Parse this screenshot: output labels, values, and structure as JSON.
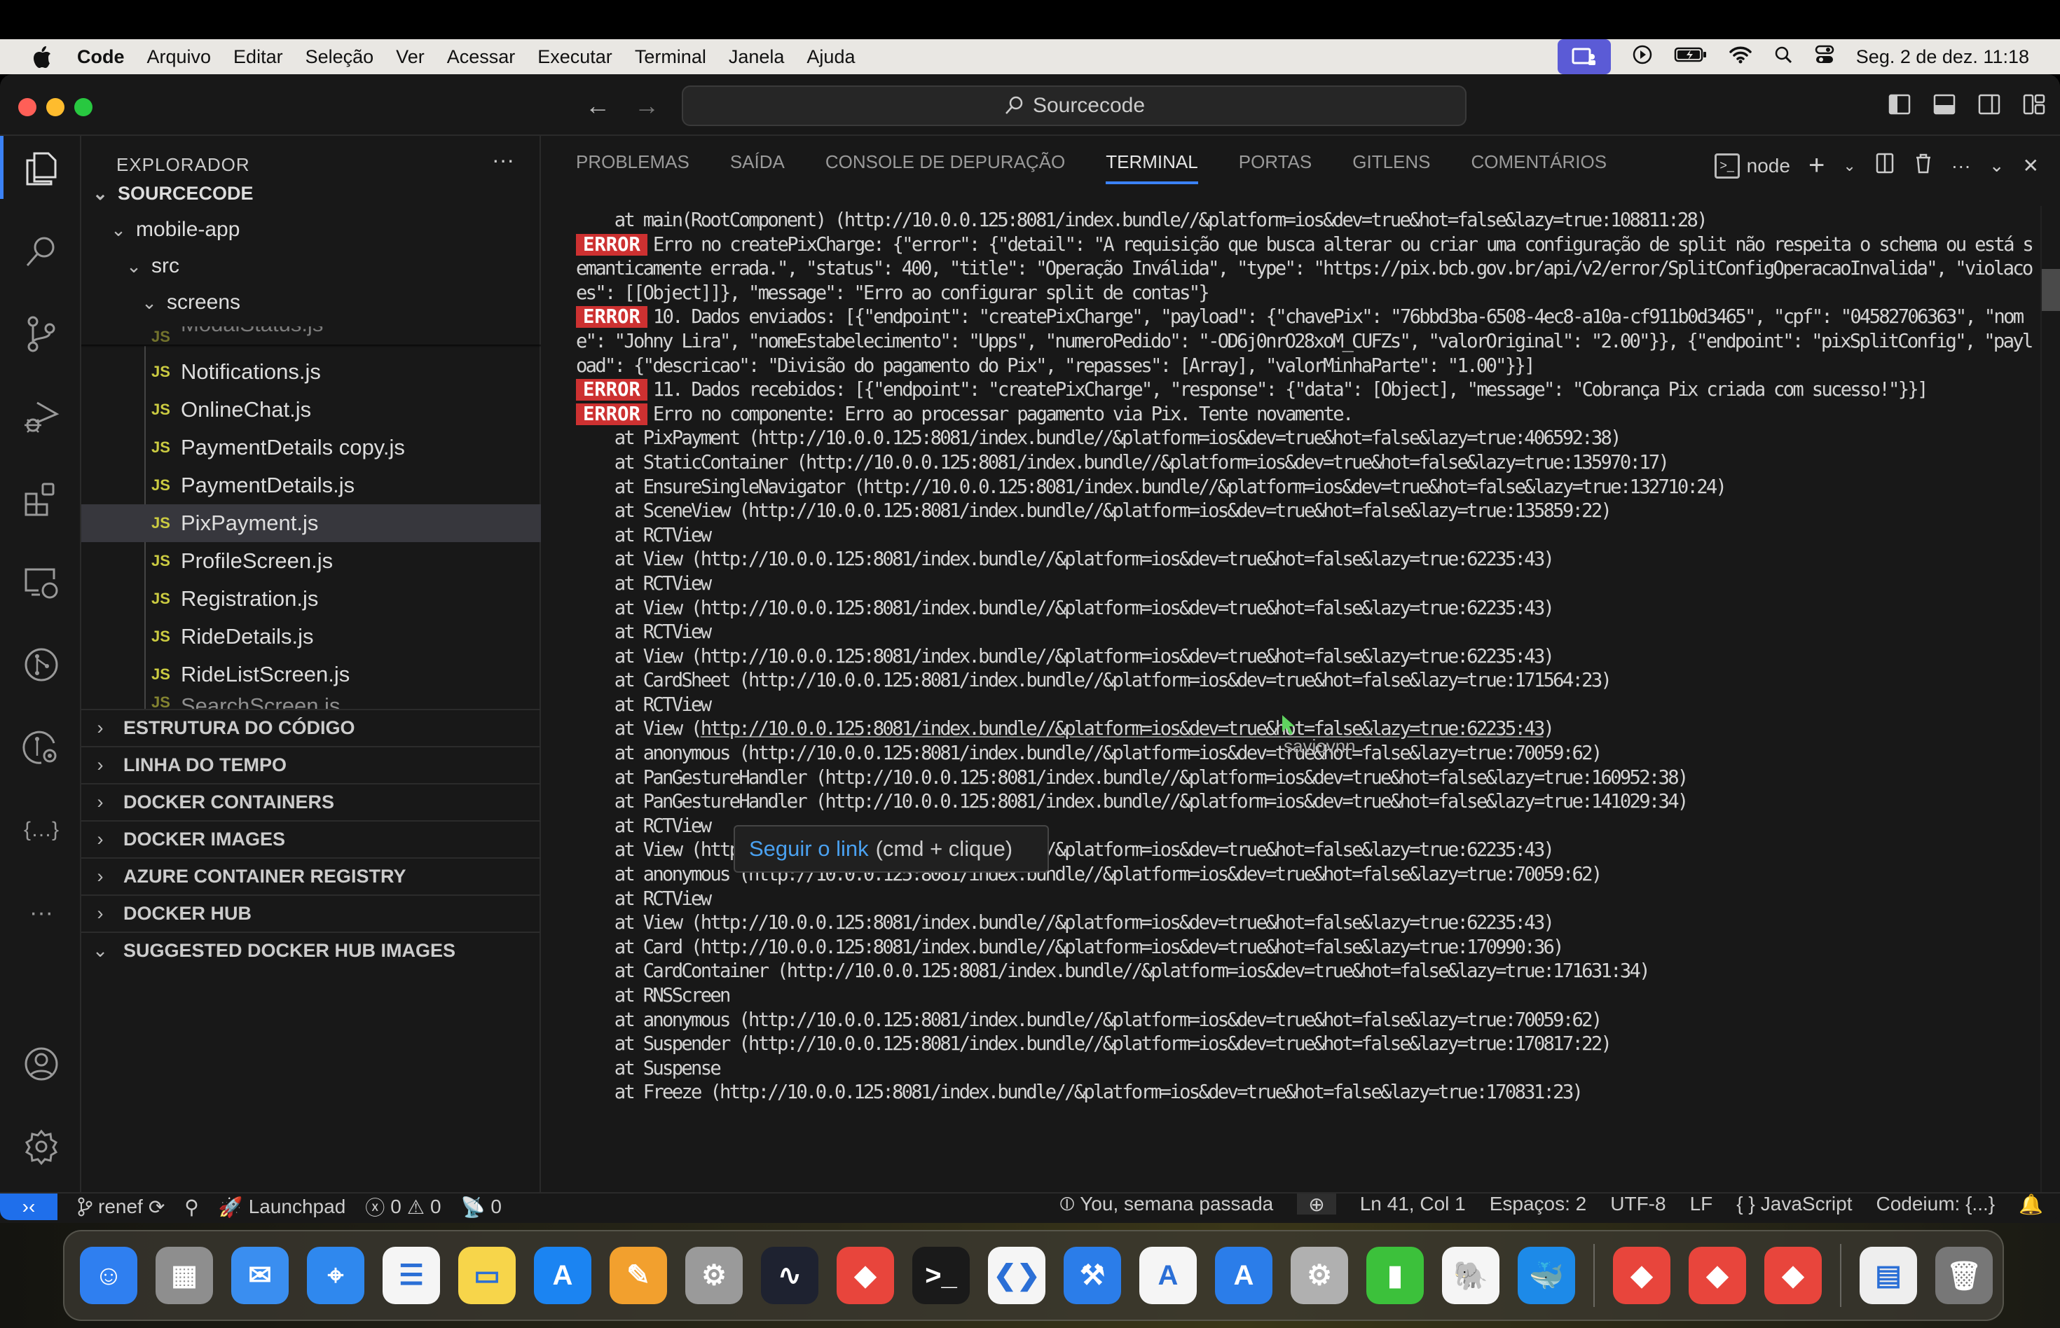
{
  "menubar": {
    "app_name": "Code",
    "items": [
      "Arquivo",
      "Editar",
      "Seleção",
      "Ver",
      "Acessar",
      "Executar",
      "Terminal",
      "Janela",
      "Ajuda"
    ],
    "clock": "Seg. 2 de dez.  11:18",
    "status_icons": [
      "screen-share-icon",
      "play-icon",
      "battery-icon",
      "wifi-icon",
      "spotlight-icon",
      "control-center-icon"
    ]
  },
  "titlebar": {
    "search_text": "Sourcecode"
  },
  "activity_bar": {
    "items": [
      "explorer",
      "search",
      "source-control",
      "run-debug",
      "extensions",
      "remote-explorer",
      "gitlens",
      "gitlens-inspect",
      "json",
      "more",
      "accounts",
      "settings"
    ]
  },
  "sidebar": {
    "title": "EXPLORADOR",
    "more": "···",
    "root": "SOURCECODE",
    "folders": [
      "mobile-app",
      "src",
      "screens"
    ],
    "partial_top_file": "ModalStatus.js",
    "files": [
      "Notifications.js",
      "OnlineChat.js",
      "PaymentDetails copy.js",
      "PaymentDetails.js",
      "PixPayment.js",
      "ProfileScreen.js",
      "Registration.js",
      "RideDetails.js",
      "RideListScreen.js"
    ],
    "selected_file": "PixPayment.js",
    "partial_bottom_file": "SearchScreen.js",
    "js_badge": "JS",
    "sections": [
      {
        "label": "ESTRUTURA DO CÓDIGO",
        "expanded": false
      },
      {
        "label": "LINHA DO TEMPO",
        "expanded": false
      },
      {
        "label": "DOCKER CONTAINERS",
        "expanded": false
      },
      {
        "label": "DOCKER IMAGES",
        "expanded": false
      },
      {
        "label": "AZURE CONTAINER REGISTRY",
        "expanded": false
      },
      {
        "label": "DOCKER HUB",
        "expanded": false
      },
      {
        "label": "SUGGESTED DOCKER HUB IMAGES",
        "expanded": true
      }
    ]
  },
  "panel": {
    "tabs": [
      "PROBLEMAS",
      "SAÍDA",
      "CONSOLE DE DEPURAÇÃO",
      "TERMINAL",
      "PORTAS",
      "GITLENS",
      "COMENTÁRIOS"
    ],
    "active_tab": "TERMINAL",
    "terminal_name": "node",
    "actions": [
      "new-terminal",
      "split-terminal",
      "kill-terminal",
      "more",
      "maximize",
      "close"
    ]
  },
  "terminal": {
    "error_badge": "ERROR",
    "lines": [
      {
        "type": "plain",
        "text": "    at main(RootComponent) (http://10.0.0.125:8081/index.bundle//&platform=ios&dev=true&hot=false&lazy=true:108811:28)"
      },
      {
        "type": "error",
        "text": "Erro no createPixCharge: {\"error\": {\"detail\": \"A requisição que busca alterar ou criar uma configuração de split não respeita o schema ou está semanticamente errada.\", \"status\": 400, \"title\": \"Operação Inválida\", \"type\": \"https://pix.bcb.gov.br/api/v2/error/SplitConfigOperacaoInvalida\", \"violacoes\": [[Object]]}, \"message\": \"Erro ao configurar split de contas\"}"
      },
      {
        "type": "error",
        "text": "10. Dados enviados: [{\"endpoint\": \"createPixCharge\", \"payload\": {\"chavePix\": \"76bbd3ba-6508-4ec8-a10a-cf911b0d3465\", \"cpf\": \"04582706363\", \"nome\": \"Johny Lira\", \"nomeEstabelecimento\": \"Upps\", \"numeroPedido\": \"-OD6j0nrO28xoM_CUFZs\", \"valorOriginal\": \"2.00\"}}, {\"endpoint\": \"pixSplitConfig\", \"payload\": {\"descricao\": \"Divisão do pagamento do Pix\", \"repasses\": [Array], \"valorMinhaParte\": \"1.00\"}}]"
      },
      {
        "type": "error",
        "text": "11. Dados recebidos: [{\"endpoint\": \"createPixCharge\", \"response\": {\"data\": [Object], \"message\": \"Cobrança Pix criada com sucesso!\"}}]"
      },
      {
        "type": "error",
        "text": "Erro no componente: Erro ao processar pagamento via Pix. Tente novamente."
      },
      {
        "type": "plain",
        "text": "    at PixPayment (http://10.0.0.125:8081/index.bundle//&platform=ios&dev=true&hot=false&lazy=true:406592:38)"
      },
      {
        "type": "plain",
        "text": "    at StaticContainer (http://10.0.0.125:8081/index.bundle//&platform=ios&dev=true&hot=false&lazy=true:135970:17)"
      },
      {
        "type": "plain",
        "text": "    at EnsureSingleNavigator (http://10.0.0.125:8081/index.bundle//&platform=ios&dev=true&hot=false&lazy=true:132710:24)"
      },
      {
        "type": "plain",
        "text": "    at SceneView (http://10.0.0.125:8081/index.bundle//&platform=ios&dev=true&hot=false&lazy=true:135859:22)"
      },
      {
        "type": "plain",
        "text": "    at RCTView"
      },
      {
        "type": "plain",
        "text": "    at View (http://10.0.0.125:8081/index.bundle//&platform=ios&dev=true&hot=false&lazy=true:62235:43)"
      },
      {
        "type": "plain",
        "text": "    at RCTView"
      },
      {
        "type": "plain",
        "text": "    at View (http://10.0.0.125:8081/index.bundle//&platform=ios&dev=true&hot=false&lazy=true:62235:43)"
      },
      {
        "type": "plain",
        "text": "    at RCTView"
      },
      {
        "type": "plain",
        "text": "    at View (http://10.0.0.125:8081/index.bundle//&platform=ios&dev=true&hot=false&lazy=true:62235:43)"
      },
      {
        "type": "plain",
        "text": "    at CardSheet (http://10.0.0.125:8081/index.bundle//&platform=ios&dev=true&hot=false&lazy=true:171564:23)"
      },
      {
        "type": "plain",
        "text": "    at RCTView"
      },
      {
        "type": "link",
        "prefix": "    at View (",
        "link": "http://10.0.0.125:8081/index.bundle//&platform=ios&dev=true&hot=false&lazy=true:62235:43",
        "suffix": ")"
      },
      {
        "type": "plain",
        "text": "    at anonymous (http://10.0.0.125:8081/index.bundle//&platform=ios&dev=true&hot=false&lazy=true:70059:62)"
      },
      {
        "type": "plain",
        "text": "    at PanGestureHandler (http://10.0.0.125:8081/index.bundle//&platform=ios&dev=true&hot=false&lazy=true:160952:38)"
      },
      {
        "type": "plain",
        "text": "    at PanGestureHandler (http://10.0.0.125:8081/index.bundle//&platform=ios&dev=true&hot=false&lazy=true:141029:34)"
      },
      {
        "type": "plain",
        "text": "    at RCTView"
      },
      {
        "type": "plain",
        "text": "    at View (http://10.0.0.125:8081/index.bundle//&platform=ios&dev=true&hot=false&lazy=true:62235:43)"
      },
      {
        "type": "plain",
        "text": "    at anonymous (http://10.0.0.125:8081/index.bundle//&platform=ios&dev=true&hot=false&lazy=true:70059:62)"
      },
      {
        "type": "plain",
        "text": "    at RCTView"
      },
      {
        "type": "plain",
        "text": "    at View (http://10.0.0.125:8081/index.bundle//&platform=ios&dev=true&hot=false&lazy=true:62235:43)"
      },
      {
        "type": "plain",
        "text": "    at Card (http://10.0.0.125:8081/index.bundle//&platform=ios&dev=true&hot=false&lazy=true:170990:36)"
      },
      {
        "type": "plain",
        "text": "    at CardContainer (http://10.0.0.125:8081/index.bundle//&platform=ios&dev=true&hot=false&lazy=true:171631:34)"
      },
      {
        "type": "plain",
        "text": "    at RNSScreen"
      },
      {
        "type": "plain",
        "text": "    at anonymous (http://10.0.0.125:8081/index.bundle//&platform=ios&dev=true&hot=false&lazy=true:70059:62)"
      },
      {
        "type": "plain",
        "text": "    at Suspender (http://10.0.0.125:8081/index.bundle//&platform=ios&dev=true&hot=false&lazy=true:170817:22)"
      },
      {
        "type": "plain",
        "text": "    at Suspense"
      },
      {
        "type": "plain",
        "text": "    at Freeze (http://10.0.0.125:8081/index.bundle//&platform=ios&dev=true&hot=false&lazy=true:170831:23)"
      }
    ]
  },
  "tooltip": {
    "link_text": "Seguir o link",
    "hint": "(cmd + clique)"
  },
  "remote_cursor": {
    "label": "saviovnn",
    "color": "#5fd35f"
  },
  "statusbar": {
    "branch": "renef",
    "launchpad": "Launchpad",
    "errors": "0",
    "warnings": "0",
    "ports": "0",
    "blame": "You, semana passada",
    "position": "Ln 41, Col 1",
    "spaces": "Espaços: 2",
    "encoding": "UTF-8",
    "eol": "LF",
    "language": "JavaScript",
    "codeium": "Codeium: {...}"
  },
  "dock": {
    "apps": [
      {
        "name": "finder",
        "glyph": "☺",
        "bg": "#2f7ff0"
      },
      {
        "name": "launchpad",
        "glyph": "▦",
        "bg": "#8e8e8e"
      },
      {
        "name": "mail",
        "glyph": "✉",
        "bg": "#3a8ef0"
      },
      {
        "name": "safari",
        "glyph": "⌖",
        "bg": "#2f88ee"
      },
      {
        "name": "reminders",
        "glyph": "☰",
        "bg": "#f5f5f5"
      },
      {
        "name": "notes",
        "glyph": "▭",
        "bg": "#f7d54a"
      },
      {
        "name": "app-store",
        "glyph": "A",
        "bg": "#1b84f2"
      },
      {
        "name": "pages",
        "glyph": "✎",
        "bg": "#f2a02e"
      },
      {
        "name": "system-settings",
        "glyph": "⚙",
        "bg": "#9a9a9a"
      },
      {
        "name": "activity-monitor",
        "glyph": "∿",
        "bg": "#1e2230"
      },
      {
        "name": "anydesk",
        "glyph": "◆",
        "bg": "#e8453c"
      },
      {
        "name": "terminal",
        "glyph": ">_",
        "bg": "#1a1a1a"
      },
      {
        "name": "vscode",
        "glyph": "❮❯",
        "bg": "#f5f5f5"
      },
      {
        "name": "xcode",
        "glyph": "⚒",
        "bg": "#2b7de9"
      },
      {
        "name": "instruments",
        "glyph": "A",
        "bg": "#f5f5f5"
      },
      {
        "name": "simulator",
        "glyph": "A",
        "bg": "#2b7de9"
      },
      {
        "name": "automator",
        "glyph": "⚙",
        "bg": "#b0b0b0"
      },
      {
        "name": "numbers",
        "glyph": "▮",
        "bg": "#3cc13b"
      },
      {
        "name": "postgres",
        "glyph": "🐘",
        "bg": "#f5f5f5"
      },
      {
        "name": "docker",
        "glyph": "🐳",
        "bg": "#1d8ae8"
      },
      {
        "name": "anydesk-2",
        "glyph": "◆",
        "bg": "#e8453c"
      },
      {
        "name": "anydesk-3",
        "glyph": "◆",
        "bg": "#e8453c"
      },
      {
        "name": "anydesk-4",
        "glyph": "◆",
        "bg": "#e8453c"
      },
      {
        "name": "recent-document",
        "glyph": "▤",
        "bg": "#eeeeee"
      },
      {
        "name": "trash",
        "glyph": "🗑",
        "bg": "#777777"
      }
    ]
  }
}
